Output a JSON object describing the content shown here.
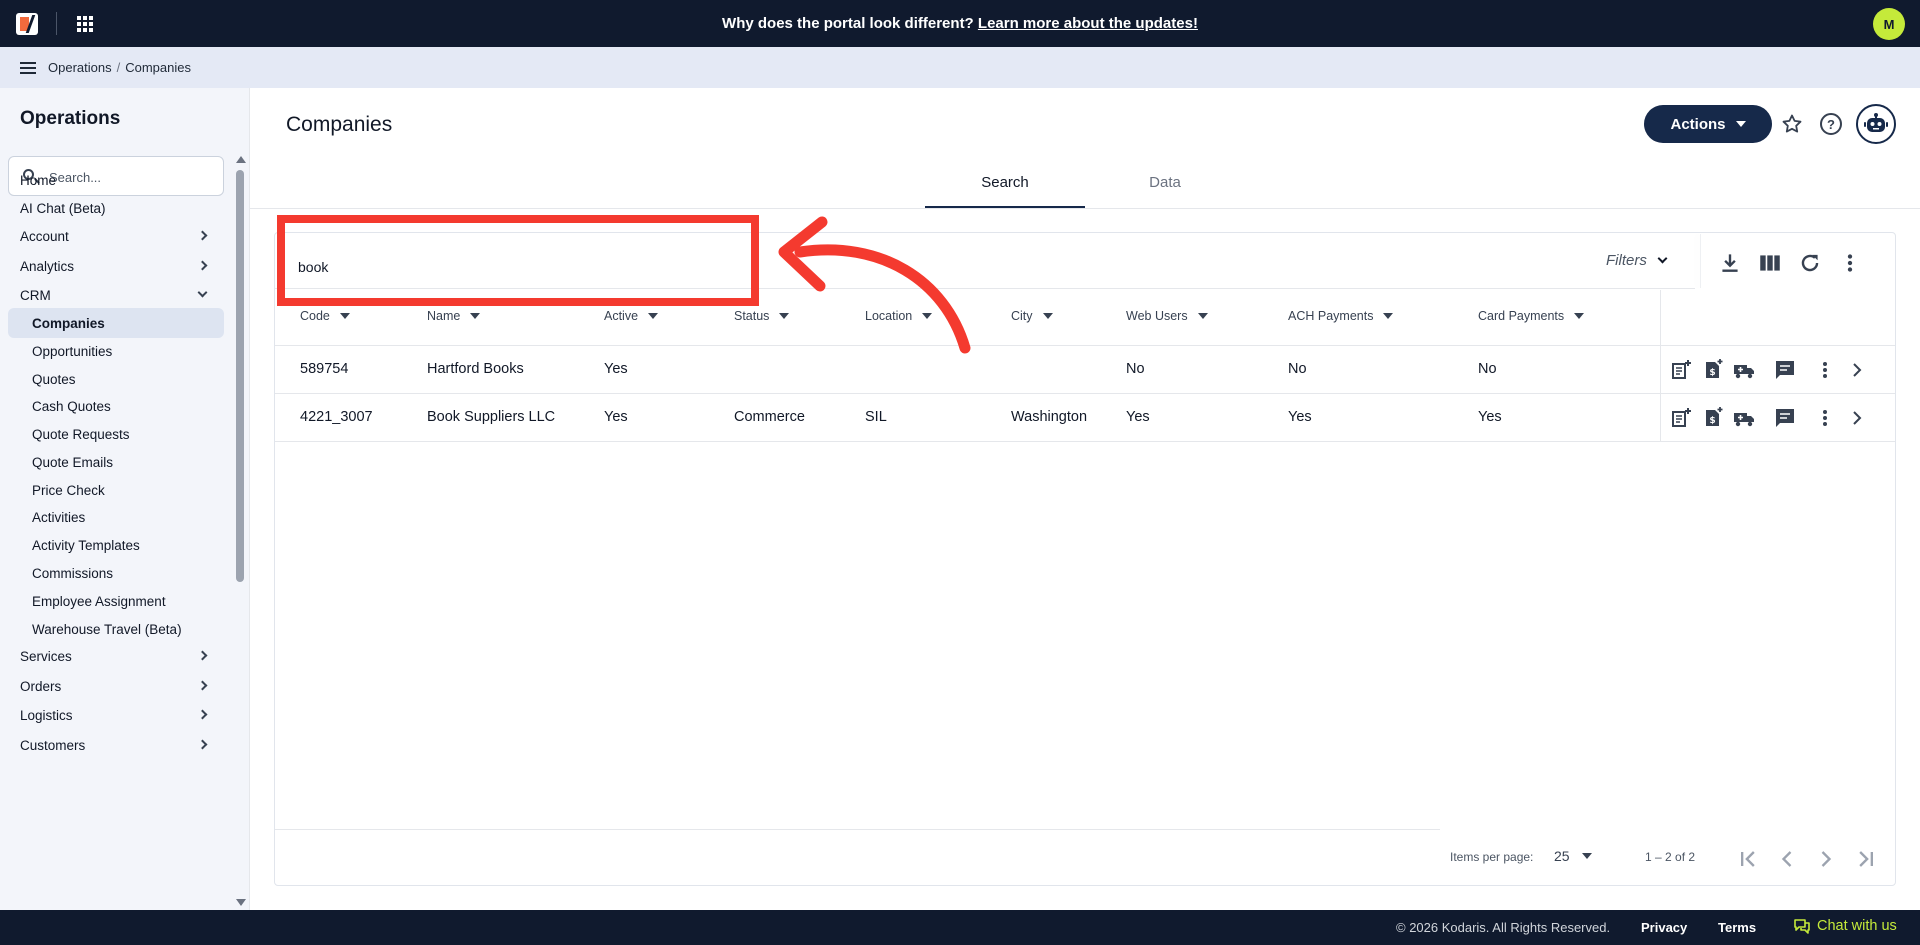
{
  "topbar": {
    "announcement_prefix": "Why does the portal look different?",
    "announcement_link": "Learn more about the updates!",
    "avatar_initial": "M"
  },
  "breadcrumb": {
    "section": "Operations",
    "separator": "/",
    "page": "Companies"
  },
  "sidebar": {
    "title": "Operations",
    "search_placeholder": "Search...",
    "items": [
      {
        "label": "Home",
        "level": "top",
        "chevron": "none"
      },
      {
        "label": "AI Chat (Beta)",
        "level": "top",
        "chevron": "none"
      },
      {
        "label": "Account",
        "level": "top",
        "chevron": "right"
      },
      {
        "label": "Analytics",
        "level": "top",
        "chevron": "right"
      },
      {
        "label": "CRM",
        "level": "top",
        "chevron": "down"
      },
      {
        "label": "Companies",
        "level": "sub",
        "chevron": "none",
        "active": true
      },
      {
        "label": "Opportunities",
        "level": "sub",
        "chevron": "none"
      },
      {
        "label": "Quotes",
        "level": "sub",
        "chevron": "none"
      },
      {
        "label": "Cash Quotes",
        "level": "sub",
        "chevron": "none"
      },
      {
        "label": "Quote Requests",
        "level": "sub",
        "chevron": "none"
      },
      {
        "label": "Quote Emails",
        "level": "sub",
        "chevron": "none"
      },
      {
        "label": "Price Check",
        "level": "sub",
        "chevron": "none"
      },
      {
        "label": "Activities",
        "level": "sub",
        "chevron": "none"
      },
      {
        "label": "Activity Templates",
        "level": "sub",
        "chevron": "none"
      },
      {
        "label": "Commissions",
        "level": "sub",
        "chevron": "none"
      },
      {
        "label": "Employee Assignment",
        "level": "sub",
        "chevron": "none"
      },
      {
        "label": "Warehouse Travel (Beta)",
        "level": "sub",
        "chevron": "none"
      },
      {
        "label": "Services",
        "level": "top",
        "chevron": "right"
      },
      {
        "label": "Orders",
        "level": "top",
        "chevron": "right"
      },
      {
        "label": "Logistics",
        "level": "top",
        "chevron": "right"
      },
      {
        "label": "Customers",
        "level": "top",
        "chevron": "right"
      }
    ]
  },
  "header": {
    "title": "Companies",
    "actions_label": "Actions"
  },
  "tabs": [
    {
      "label": "Search",
      "active": true
    },
    {
      "label": "Data",
      "active": false
    }
  ],
  "grid": {
    "search_value": "book",
    "filters_label": "Filters",
    "toolbar_icons": [
      "download-icon",
      "columns-icon",
      "refresh-icon",
      "more-vert-icon"
    ],
    "columns": [
      "Code",
      "Name",
      "Active",
      "Status",
      "Location",
      "City",
      "Web Users",
      "ACH Payments",
      "Card Payments"
    ],
    "rows": [
      [
        "589754",
        "Hartford Books",
        "Yes",
        "",
        "",
        "",
        "No",
        "No",
        "No"
      ],
      [
        "4221_3007",
        "Book Suppliers LLC",
        "Yes",
        "Commerce",
        "SIL",
        "Washington",
        "Yes",
        "Yes",
        "Yes"
      ]
    ],
    "row_action_icons": [
      "new-quote-icon",
      "new-invoice-icon",
      "shipping-icon",
      "comment-icon",
      "more-vert-icon",
      "chevron-right-icon"
    ]
  },
  "pagination": {
    "items_per_page_label": "Items per page:",
    "items_per_page": "25",
    "range": "1 – 2 of 2"
  },
  "annotation": {
    "color": "#f43a2f"
  },
  "footer": {
    "copyright": "© 2026 Kodaris. All Rights Reserved.",
    "privacy": "Privacy",
    "terms": "Terms",
    "chat": "Chat with us"
  },
  "colors": {
    "nav_dark": "#101a2e",
    "primary": "#16294a",
    "accent": "#c5ea3a",
    "brand_orange": "#f26a3d"
  }
}
